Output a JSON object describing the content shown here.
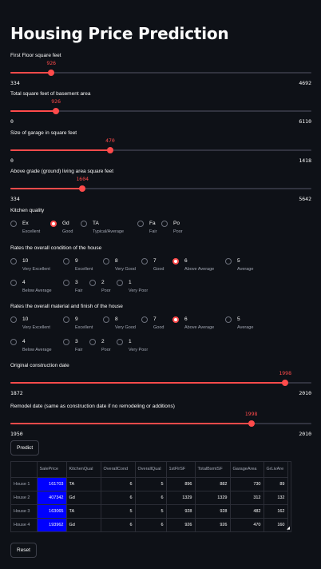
{
  "title": "Housing Price Prediction",
  "sliders": [
    {
      "id": "first-floor",
      "label": "First Floor square feet",
      "value": 926,
      "min": 334,
      "max": 4692
    },
    {
      "id": "basement",
      "label": "Total square feet of basement area",
      "value": 926,
      "min": 0,
      "max": 6110
    },
    {
      "id": "garage",
      "label": "Size of garage in square feet",
      "value": 470,
      "min": 0,
      "max": 1418
    },
    {
      "id": "living-area",
      "label": "Above grade (ground) living area square feet",
      "value": 1604,
      "min": 334,
      "max": 5642
    }
  ],
  "kitchen_quality": {
    "label": "Kitchen quality",
    "selected": "Gd",
    "options": [
      {
        "value": "Ex",
        "caption": "Excellent"
      },
      {
        "value": "Gd",
        "caption": "Good"
      },
      {
        "value": "TA",
        "caption": "Typical/Average"
      },
      {
        "value": "Fa",
        "caption": "Fair"
      },
      {
        "value": "Po",
        "caption": "Poor"
      }
    ]
  },
  "overall_condition": {
    "label": "Rates the overall condition of the house",
    "selected": "6",
    "options": [
      {
        "value": "10",
        "caption": "Very Excellent"
      },
      {
        "value": "9",
        "caption": "Excellent"
      },
      {
        "value": "8",
        "caption": "Very Good"
      },
      {
        "value": "7",
        "caption": "Good"
      },
      {
        "value": "6",
        "caption": "Above Average"
      },
      {
        "value": "5",
        "caption": "Average"
      },
      {
        "value": "4",
        "caption": "Below Average"
      },
      {
        "value": "3",
        "caption": "Fair"
      },
      {
        "value": "2",
        "caption": "Poor"
      },
      {
        "value": "1",
        "caption": "Very Poor"
      }
    ]
  },
  "overall_quality": {
    "label": "Rates the overall material and finish of the house",
    "selected": "6",
    "options": [
      {
        "value": "10",
        "caption": "Very Excellent"
      },
      {
        "value": "9",
        "caption": "Excellent"
      },
      {
        "value": "8",
        "caption": "Very Good"
      },
      {
        "value": "7",
        "caption": "Good"
      },
      {
        "value": "6",
        "caption": "Above Average"
      },
      {
        "value": "5",
        "caption": "Average"
      },
      {
        "value": "4",
        "caption": "Below Average"
      },
      {
        "value": "3",
        "caption": "Fair"
      },
      {
        "value": "2",
        "caption": "Poor"
      },
      {
        "value": "1",
        "caption": "Very Poor"
      }
    ]
  },
  "year_sliders": [
    {
      "id": "year-built",
      "label": "Original construction date",
      "value": 1998,
      "min": 1872,
      "max": 2010
    },
    {
      "id": "remodel",
      "label": "Remodel date (same as construction date if no remodeling or additions)",
      "value": 1998,
      "min": 1950,
      "max": 2010
    }
  ],
  "predict_button": "Predict",
  "reset_button": "Reset",
  "table": {
    "columns": [
      "",
      "SalePrice",
      "KitchenQual",
      "OverallCond",
      "OverallQual",
      "1stFlrSF",
      "TotalBsmtSF",
      "GarageArea",
      "GrLivAre"
    ],
    "rows": [
      {
        "label": "House 1",
        "cells": [
          "161703",
          "TA",
          "6",
          "5",
          "896",
          "882",
          "730",
          "89"
        ]
      },
      {
        "label": "House 2",
        "cells": [
          "407342",
          "Gd",
          "6",
          "6",
          "1329",
          "1329",
          "312",
          "132"
        ]
      },
      {
        "label": "House 3",
        "cells": [
          "163065",
          "TA",
          "5",
          "5",
          "928",
          "928",
          "482",
          "162"
        ]
      },
      {
        "label": "House 4",
        "cells": [
          "193962",
          "Gd",
          "6",
          "6",
          "926",
          "926",
          "470",
          "160"
        ]
      }
    ]
  },
  "colors": {
    "accent": "#ff4b4b",
    "background": "#0e1117",
    "highlight": "#0000ff"
  }
}
